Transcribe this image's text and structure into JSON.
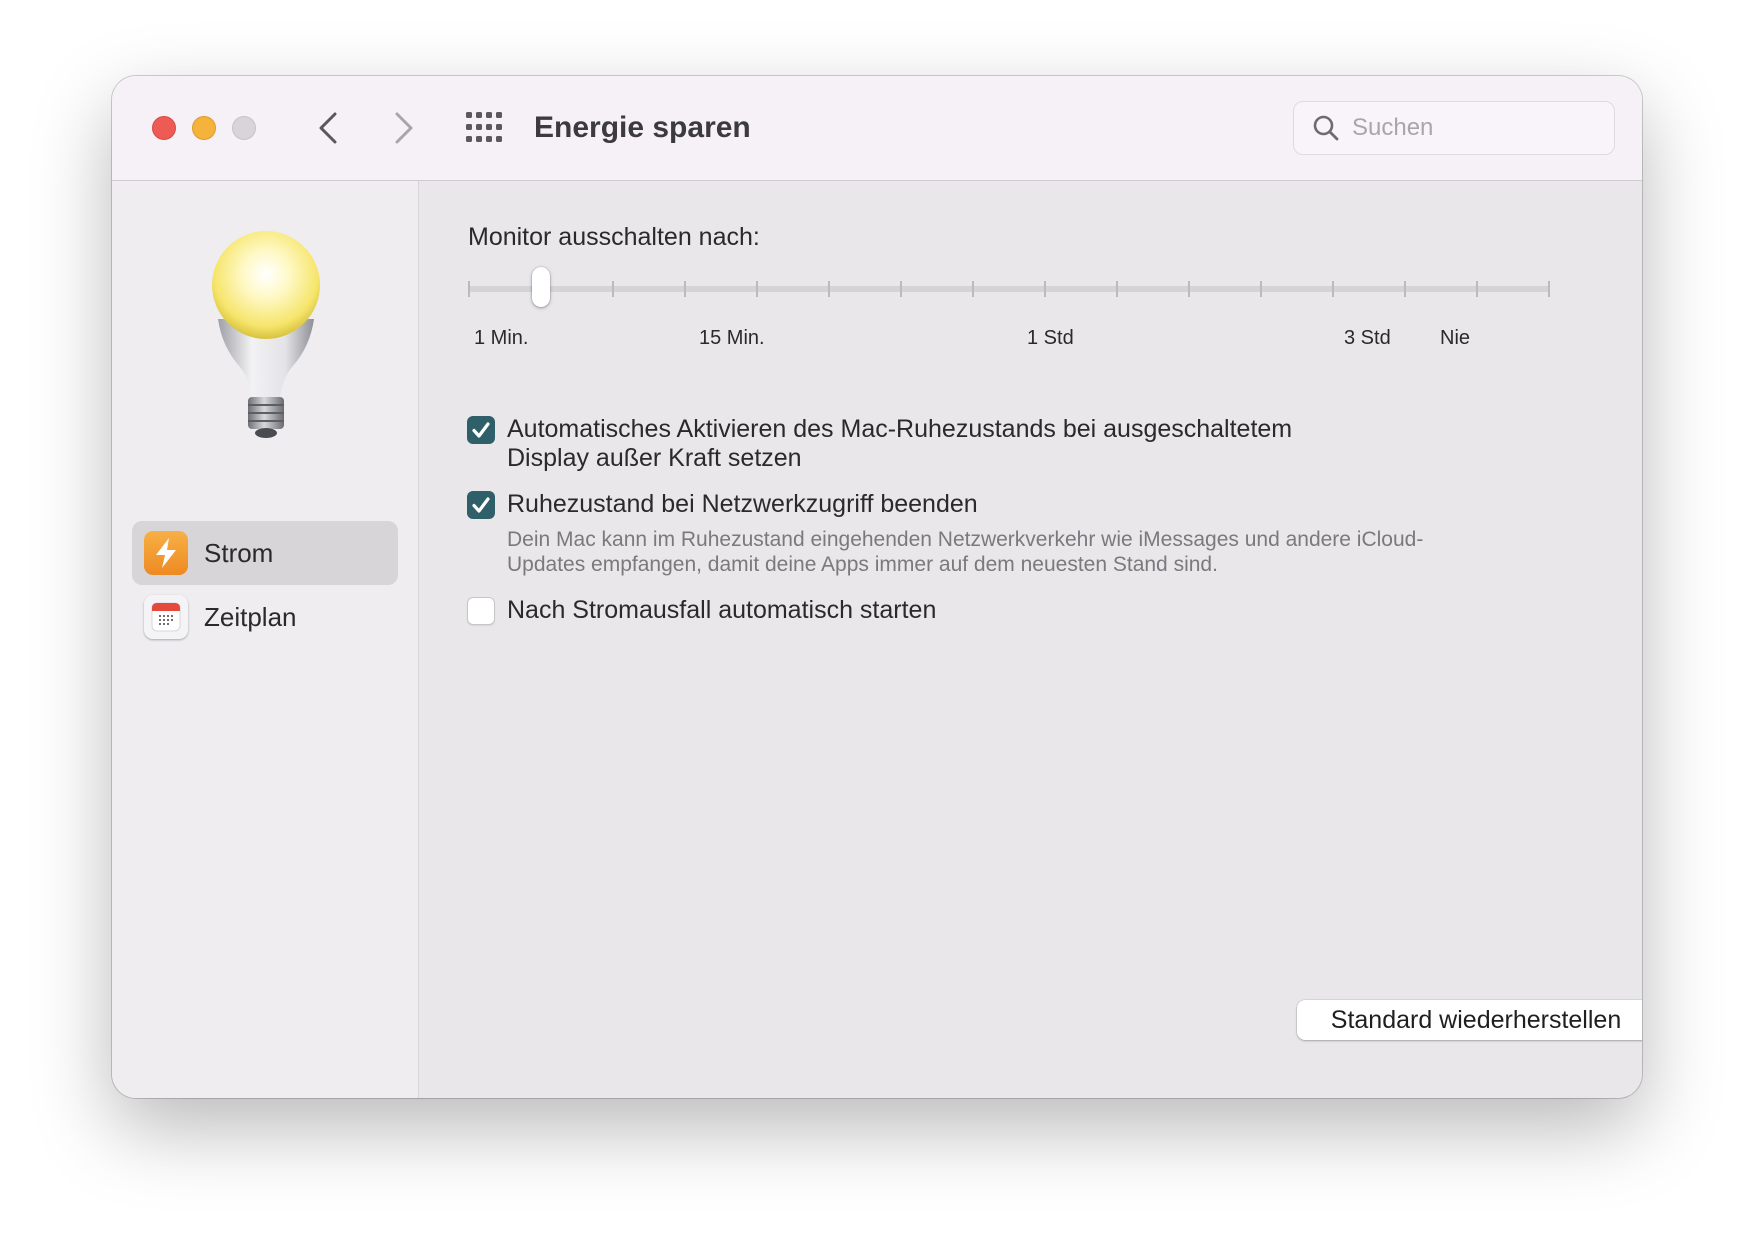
{
  "window": {
    "title": "Energie sparen",
    "search_placeholder": "Suchen"
  },
  "sidebar": {
    "items": [
      {
        "label": "Strom",
        "icon": "bolt-icon",
        "selected": true,
        "color": "#f29a2e"
      },
      {
        "label": "Zeitplan",
        "icon": "calendar-icon",
        "selected": false,
        "color": "#e5483d"
      }
    ]
  },
  "display_sleep": {
    "label": "Monitor ausschalten nach:",
    "tick_labels": [
      "1 Min.",
      "15 Min.",
      "1 Std",
      "3 Std",
      "Nie"
    ],
    "tick_count": 16,
    "selected_tick_index": 1
  },
  "options": [
    {
      "label_line1": "Automatisches Aktivieren des Mac-Ruhezustands bei ausgeschaltetem",
      "label_line2": "Display außer Kraft setzen",
      "checked": true
    },
    {
      "label": "Ruhezustand bei Netzwerkzugriff beenden",
      "checked": true,
      "help_line1": "Dein Mac kann im Ruhezustand eingehenden Netzwerkverkehr wie iMessages und andere iCloud-",
      "help_line2": "Updates empfangen, damit deine Apps immer auf dem neuesten Stand sind."
    },
    {
      "label": "Nach Stromausfall automatisch starten",
      "checked": false
    }
  ],
  "buttons": {
    "restore_defaults": "Standard wiederherstellen",
    "help": "?"
  },
  "colors": {
    "accent_checkbox": "#2f5f69",
    "close": "#ee5b54",
    "minimize": "#f5b33c",
    "zoom_disabled": "#d8d4d9"
  }
}
